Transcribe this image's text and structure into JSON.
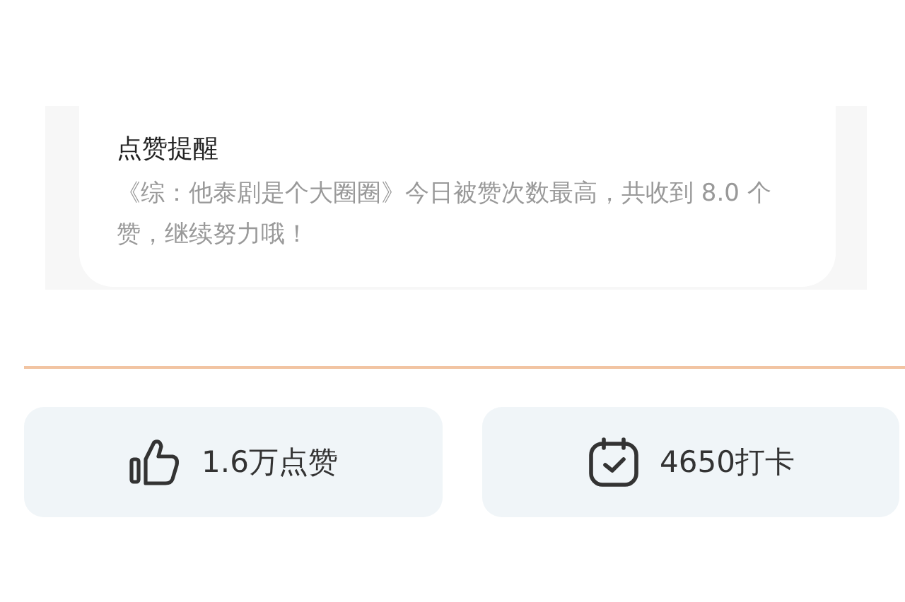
{
  "notice": {
    "title": "点赞提醒",
    "message": "《综：他泰剧是个大圈圈》今日被赞次数最高，共收到 8.0 个赞，继续努力哦！"
  },
  "stats": [
    {
      "kind": "likes",
      "label": "1.6万点赞"
    },
    {
      "kind": "checkin",
      "label": "4650打卡"
    }
  ]
}
